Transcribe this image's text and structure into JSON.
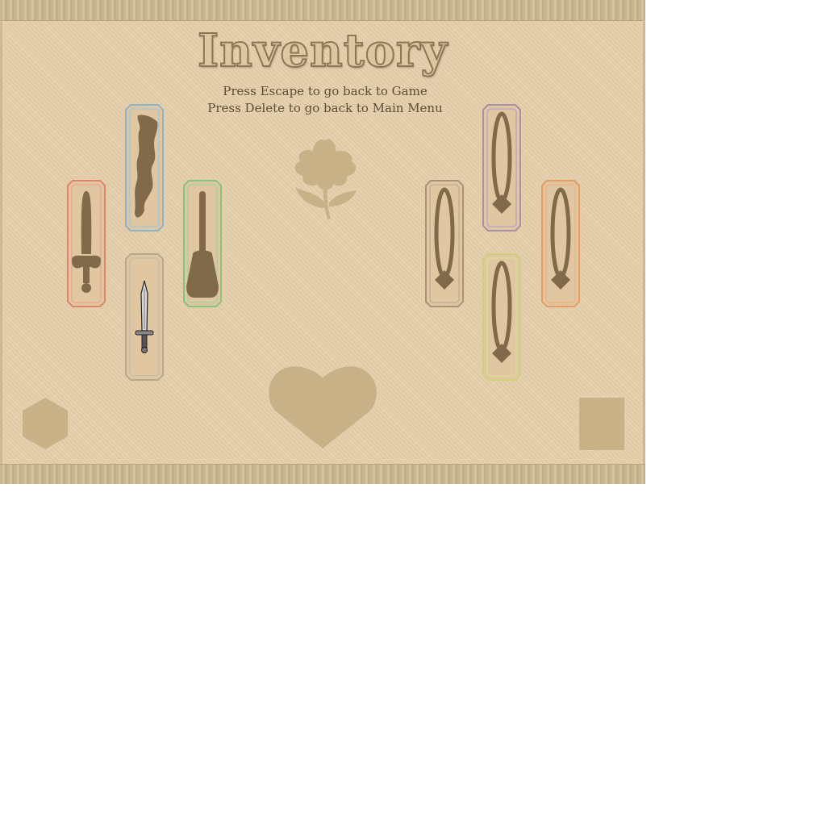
{
  "title": "Inventory",
  "hints": {
    "escape": "Press Escape to go back to Game",
    "delete": "Press Delete to go back to Main Menu"
  },
  "colors": {
    "parchment": "#e4ceaa",
    "emblem": "#c9b187",
    "silhouette": "#806a4a",
    "slot_red": "#e2836a",
    "slot_blue": "#8fb3c5",
    "slot_green": "#86c47c",
    "slot_gray": "#b5a98f",
    "slot_tan": "#a99275",
    "slot_purple": "#a890a8",
    "slot_orange": "#e59d62",
    "slot_yellow": "#cfd07d"
  },
  "left_equipment": [
    {
      "slot": "red",
      "item_icon": "sword-silhouette-icon"
    },
    {
      "slot": "blue",
      "item_icon": "armor-silhouette-icon"
    },
    {
      "slot": "green",
      "item_icon": "shovel-silhouette-icon"
    },
    {
      "slot": "gray",
      "item_icon": "steel-dagger-icon"
    }
  ],
  "right_equipment": [
    {
      "slot": "tan",
      "item_icon": "amulet-silhouette-icon"
    },
    {
      "slot": "purple",
      "item_icon": "amulet-silhouette-icon"
    },
    {
      "slot": "orange",
      "item_icon": "amulet-silhouette-icon"
    },
    {
      "slot": "yellow",
      "item_icon": "amulet-silhouette-icon"
    }
  ],
  "emblems": [
    "flower-icon",
    "heart-icon",
    "hexagon-icon",
    "square-icon"
  ]
}
